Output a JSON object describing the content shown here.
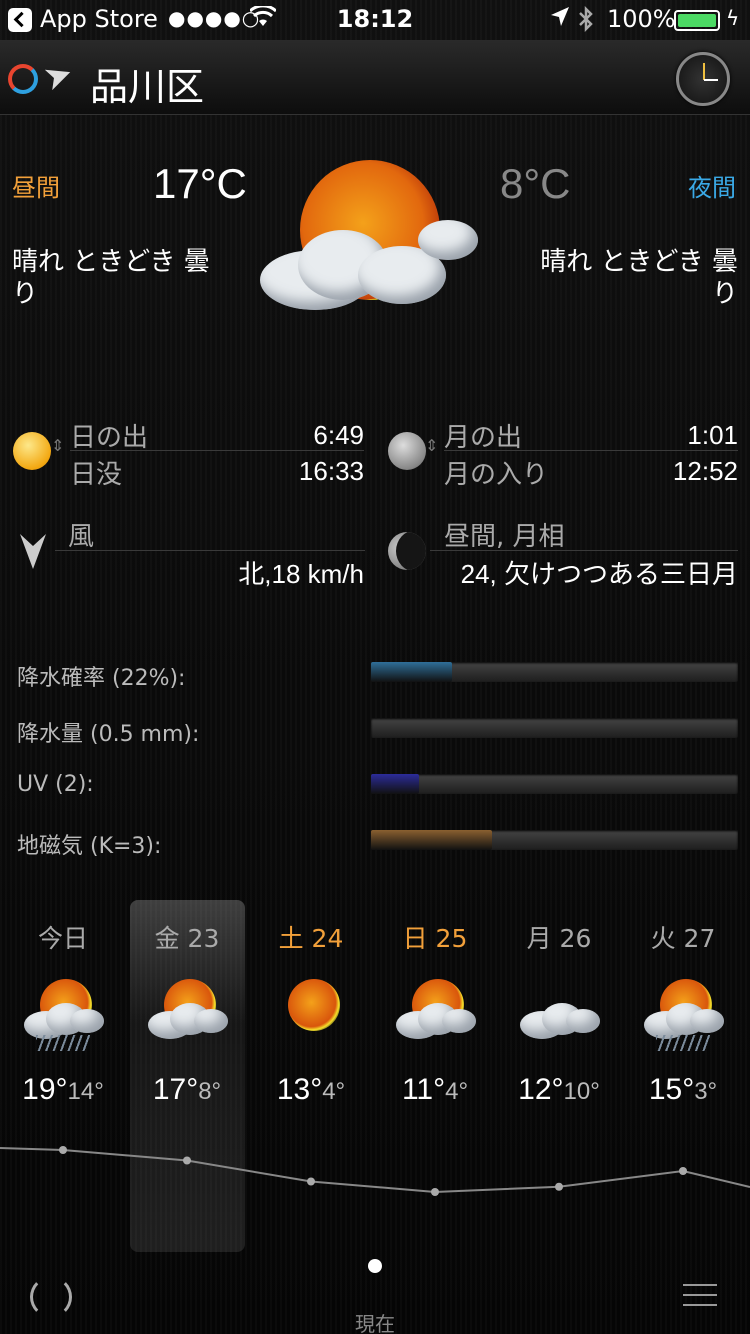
{
  "status_bar": {
    "app": "App Store",
    "signal": "●●●●○",
    "time": "18:12",
    "battery": "100%"
  },
  "header": {
    "city": "品川区"
  },
  "today": {
    "day_label": "昼間",
    "night_label": "夜間",
    "day_temp": "17°C",
    "night_temp": "8°C",
    "day_condition": "晴れ ときどき 曇り",
    "night_condition": "晴れ ときどき 曇り"
  },
  "astro": {
    "sunrise_label": "日の出",
    "sunrise": "6:49",
    "sunset_label": "日没",
    "sunset": "16:33",
    "moonrise_label": "月の出",
    "moonrise": "1:01",
    "moonset_label": "月の入り",
    "moonset": "12:52",
    "wind_label": "風",
    "wind": "北,18 km/h",
    "phase_label": "昼間, 月相",
    "phase": "24, 欠けつつある三日月"
  },
  "bars": [
    {
      "label": "降水確率 (22%):",
      "fraction": 0.22,
      "color": "#2f6f99"
    },
    {
      "label": "降水量 (0.5 mm):",
      "fraction": 0.0,
      "color": "#2f6f99"
    },
    {
      "label": "UV (2):",
      "fraction": 0.13,
      "color": "#2c2c9a"
    },
    {
      "label": "地磁気 (K=3):",
      "fraction": 0.33,
      "color": "#8a6030"
    }
  ],
  "forecast": [
    {
      "day": "今日",
      "high": "19°",
      "low": "14°",
      "weekend": false,
      "icon": "partly-cloudy-rain-icon"
    },
    {
      "day": "金 23",
      "high": "17°",
      "low": "8°",
      "weekend": false,
      "icon": "partly-cloudy-icon"
    },
    {
      "day": "土 24",
      "high": "13°",
      "low": "4°",
      "weekend": true,
      "icon": "sunny-icon"
    },
    {
      "day": "日 25",
      "high": "11°",
      "low": "4°",
      "weekend": true,
      "icon": "partly-cloudy-icon"
    },
    {
      "day": "月 26",
      "high": "12°",
      "low": "10°",
      "weekend": false,
      "icon": "cloudy-icon"
    },
    {
      "day": "火 27",
      "high": "15°",
      "low": "3°",
      "weekend": false,
      "icon": "partly-cloudy-rain-icon"
    }
  ],
  "footer": {
    "now_label": "現在"
  }
}
